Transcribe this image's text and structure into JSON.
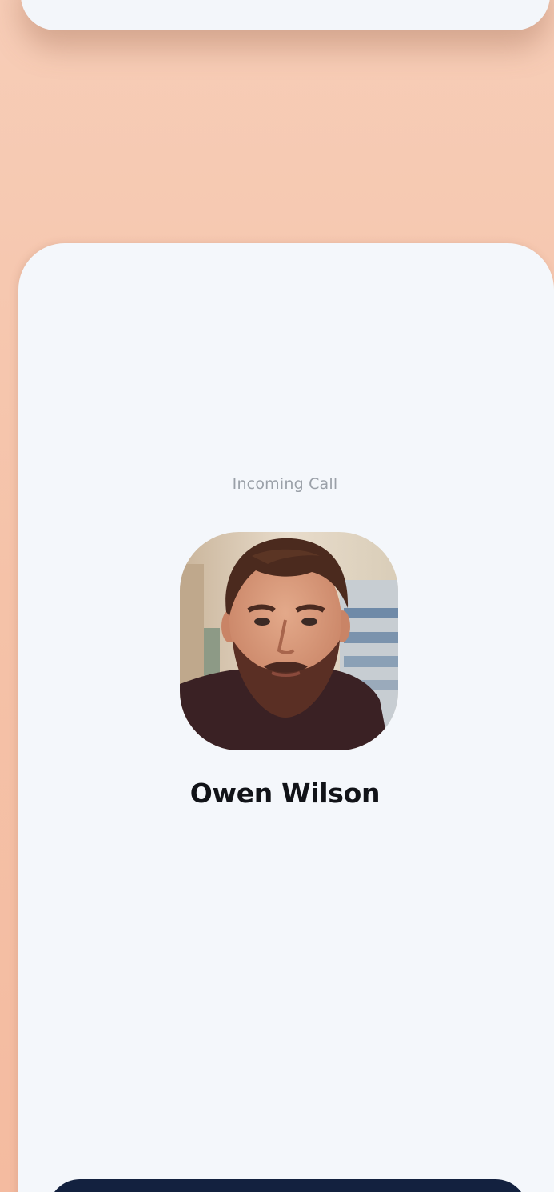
{
  "call": {
    "status_label": "Incoming Call",
    "caller_name": "Owen Wilson"
  },
  "colors": {
    "background": "#f6c4ab",
    "card": "#f4f7fb",
    "action_bar": "#13213f",
    "status_text": "#9aa0a8",
    "name_text": "#111318"
  }
}
